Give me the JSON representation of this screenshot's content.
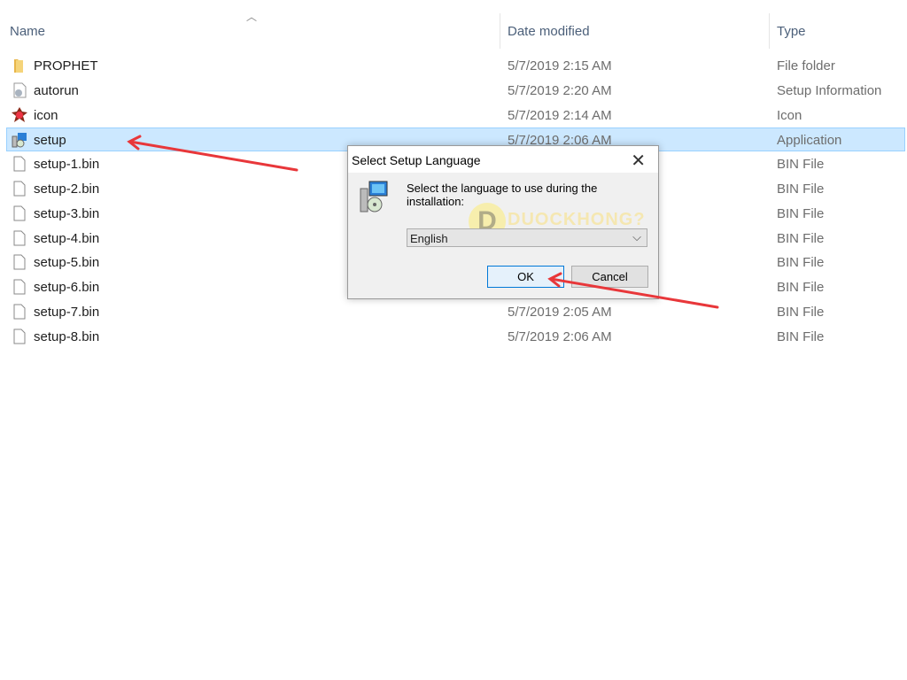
{
  "columns": {
    "name": "Name",
    "date": "Date modified",
    "type": "Type"
  },
  "files": [
    {
      "name": "PROPHET",
      "date": "5/7/2019 2:15 AM",
      "type": "File folder",
      "icon": "folder-icon"
    },
    {
      "name": "autorun",
      "date": "5/7/2019 2:20 AM",
      "type": "Setup Information",
      "icon": "settings-file-icon"
    },
    {
      "name": "icon",
      "date": "5/7/2019 2:14 AM",
      "type": "Icon",
      "icon": "icon-file-icon"
    },
    {
      "name": "setup",
      "date": "5/7/2019 2:06 AM",
      "type": "Application",
      "icon": "installer-icon",
      "selected": true
    },
    {
      "name": "setup-1.bin",
      "date": "",
      "type": "BIN File",
      "icon": "file-icon"
    },
    {
      "name": "setup-2.bin",
      "date": "",
      "type": "BIN File",
      "icon": "file-icon"
    },
    {
      "name": "setup-3.bin",
      "date": "",
      "type": "BIN File",
      "icon": "file-icon"
    },
    {
      "name": "setup-4.bin",
      "date": "",
      "type": "BIN File",
      "icon": "file-icon"
    },
    {
      "name": "setup-5.bin",
      "date": "",
      "type": "BIN File",
      "icon": "file-icon"
    },
    {
      "name": "setup-6.bin",
      "date": "",
      "type": "BIN File",
      "icon": "file-icon"
    },
    {
      "name": "setup-7.bin",
      "date": "5/7/2019 2:05 AM",
      "type": "BIN File",
      "icon": "file-icon"
    },
    {
      "name": "setup-8.bin",
      "date": "5/7/2019 2:06 AM",
      "type": "BIN File",
      "icon": "file-icon"
    }
  ],
  "dialog": {
    "title": "Select Setup Language",
    "message": "Select the language to use during the installation:",
    "language": "English",
    "ok": "OK",
    "cancel": "Cancel"
  },
  "watermark": {
    "letter": "D",
    "text": "DUOCKHONG?"
  },
  "colors": {
    "selection": "#cce8ff",
    "arrow": "#e8373a",
    "accent": "#0078d7"
  }
}
